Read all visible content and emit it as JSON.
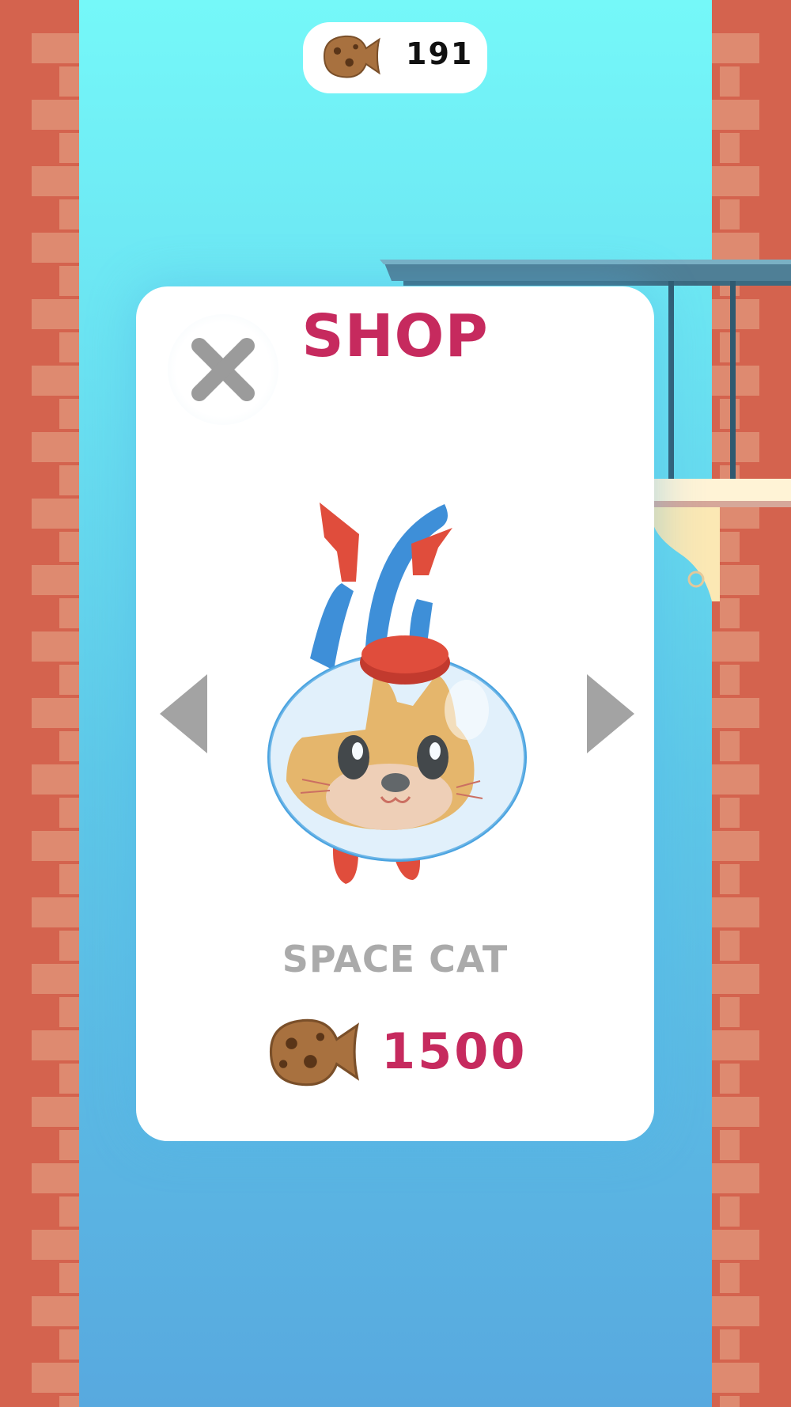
{
  "hud": {
    "coin_icon": "fish-cookie-icon",
    "coins": "191"
  },
  "shop": {
    "title": "SHOP",
    "close_icon": "close-icon",
    "prev_icon": "arrow-left-icon",
    "next_icon": "arrow-right-icon",
    "item": {
      "name": "SPACE CAT",
      "price_icon": "fish-cookie-icon",
      "price": "1500"
    }
  },
  "colors": {
    "accent": "#c62a5e",
    "muted": "#aaaaaa",
    "brick": "#d4634e",
    "sky_top": "#75f8f9",
    "sky_bottom": "#58a9df"
  }
}
